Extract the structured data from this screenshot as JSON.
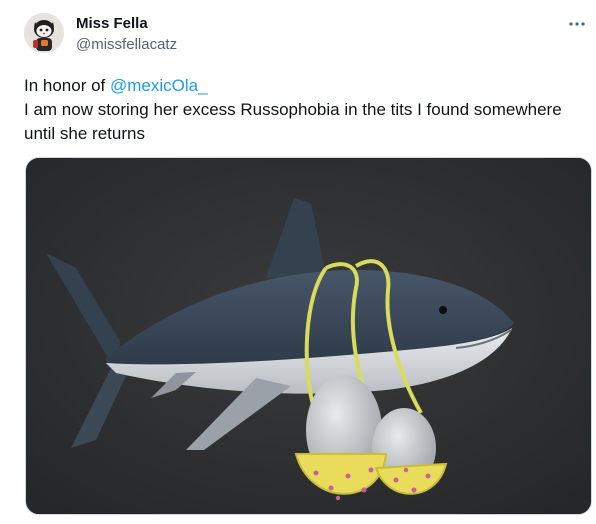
{
  "author": {
    "display_name": "Miss Fella",
    "handle": "@missfellacatz"
  },
  "tweet": {
    "prefix": "In honor of ",
    "mention": "@mexicOla_",
    "line2": "I am now storing her excess Russophobia in the tits I found somewhere",
    "line3": "until she returns"
  },
  "icons": {
    "more": "more-horizontal-icon"
  },
  "colors": {
    "mention": "#1d9bf0",
    "secondary_text": "#536471",
    "media_background": "#2c2d2e"
  }
}
